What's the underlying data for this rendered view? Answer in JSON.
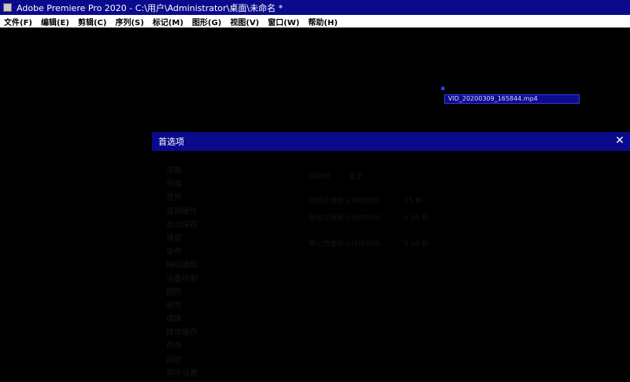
{
  "window": {
    "title": "Adobe Premiere Pro 2020 - C:\\用户\\Administrator\\桌面\\未命名 *",
    "icon": "premiere-app-icon"
  },
  "menu": [
    "文件(F)",
    "编辑(E)",
    "剪辑(C)",
    "序列(S)",
    "标记(M)",
    "图形(G)",
    "视图(V)",
    "窗口(W)",
    "帮助(H)"
  ],
  "project": {
    "file_name": "VID_20200309_165844.mp4"
  },
  "dialog": {
    "title": "首选项",
    "close_icon": "close-icon",
    "categories": [
      "常规",
      "外观",
      "音频",
      "音频硬件",
      "自动保存",
      "捕捉",
      "协作",
      "操纵面板",
      "设备控制",
      "图形",
      "标签",
      "媒体",
      "媒体缓存",
      "内存",
      "回放",
      "同步设置"
    ],
    "settings": {
      "row1_label": "启动时:",
      "row1_value": "显示",
      "row2_label": "视频过渡默认持续时间:",
      "row2_value": "25 帧",
      "row3_label": "音频过渡默认持续时间:",
      "row3_value": "1.00 秒",
      "row4_label": "静止图像默认持续时间:",
      "row4_value": "5.00 秒"
    }
  }
}
